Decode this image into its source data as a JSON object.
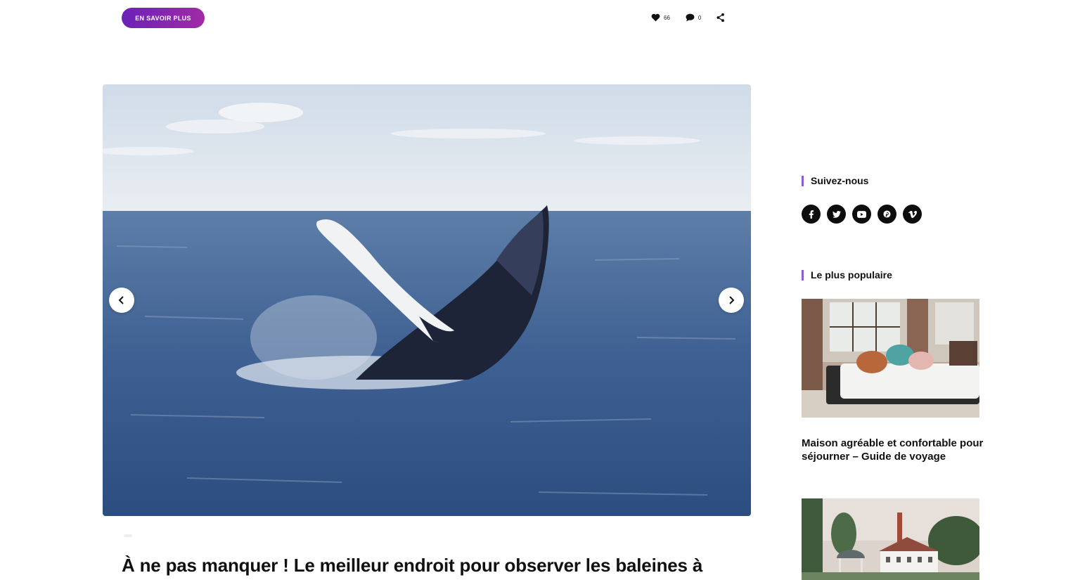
{
  "header": {
    "cta_label": "EN SAVOIR PLUS",
    "likes_count": "66",
    "comments_count": "0"
  },
  "article": {
    "title": "À ne pas manquer ! Le meilleur endroit pour observer les baleines à"
  },
  "sidebar": {
    "follow_heading": "Suivez-nous",
    "social": [
      "facebook-icon",
      "twitter-icon",
      "youtube-icon",
      "pinterest-icon",
      "vimeo-icon"
    ],
    "popular_heading": "Le plus populaire",
    "posts": [
      {
        "title": "Maison agréable et confortable pour séjourner – Guide de voyage"
      }
    ]
  },
  "colors": {
    "accent": "#8b5fd1",
    "button_gradient_start": "#6a22b8",
    "button_gradient_end": "#a12aa6"
  }
}
